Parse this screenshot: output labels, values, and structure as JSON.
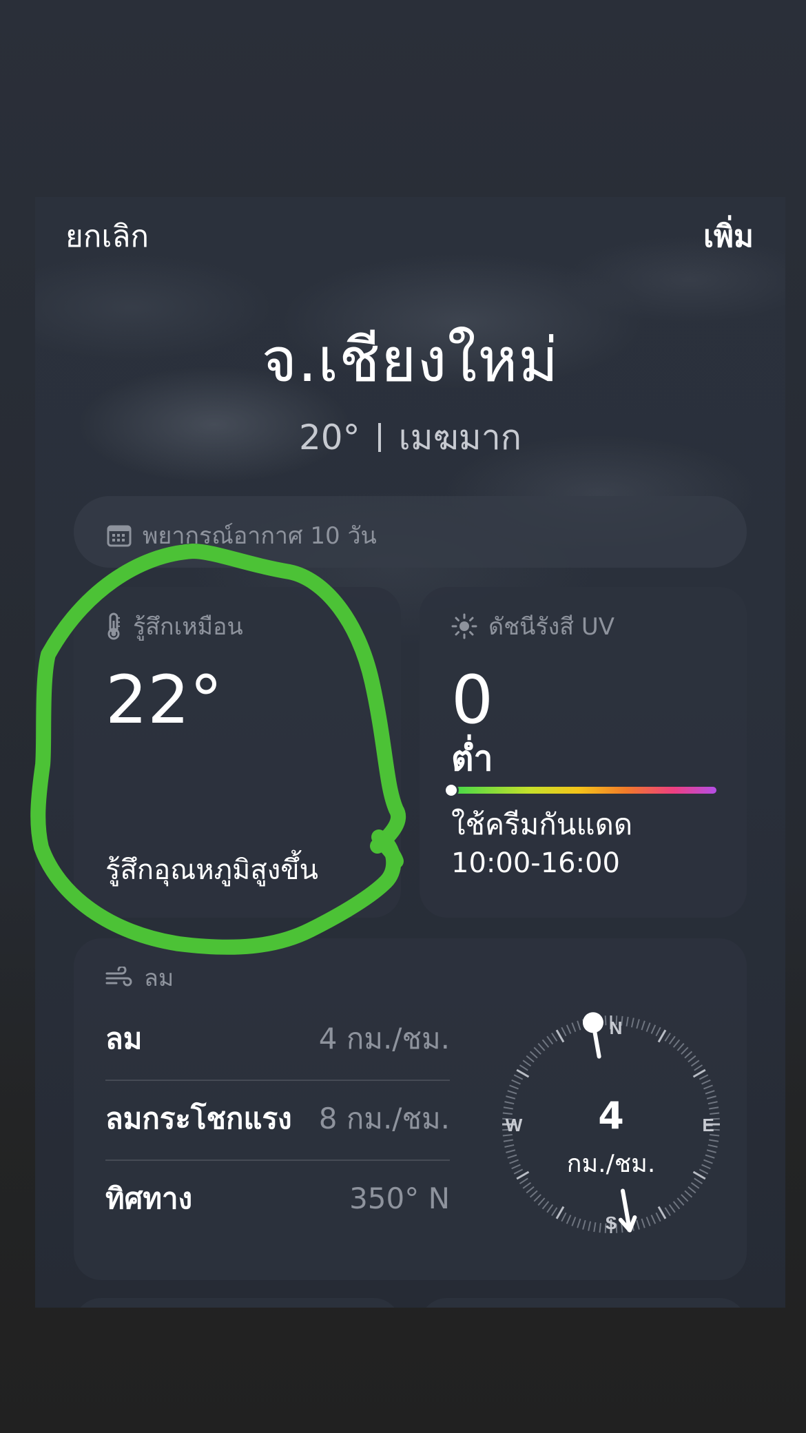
{
  "nav": {
    "cancel_label": "ยกเลิก",
    "add_label": "เพิ่ม"
  },
  "location": {
    "city": "จ.เชียงใหม่",
    "temperature": "20°",
    "condition": "เมฆมาก"
  },
  "forecast": {
    "icon": "calendar-icon",
    "label": "พยากรณ์อากาศ 10 วัน"
  },
  "feels_like": {
    "icon": "thermometer-icon",
    "title": "รู้สึกเหมือน",
    "value": "22°",
    "description": "รู้สึกอุณหภูมิสูงขึ้น"
  },
  "uv_index": {
    "icon": "sun-icon",
    "title": "ดัชนีรังสี UV",
    "value": "0",
    "level": "ต่ำ",
    "level_fraction": 0,
    "advice": "ใช้ครีมกันแดด",
    "time_range": "10:00-16:00"
  },
  "wind": {
    "icon": "wind-icon",
    "title": "ลม",
    "rows": [
      {
        "label": "ลม",
        "value": "4 กม./ชม."
      },
      {
        "label": "ลมกระโชกแรง",
        "value": "8 กม./ชม."
      },
      {
        "label": "ทิศทาง",
        "value": "350° N"
      }
    ],
    "compass": {
      "speed": "4",
      "unit": "กม./ชม.",
      "direction_degrees": 350,
      "north": "N",
      "east": "E",
      "south": "S",
      "west": "W"
    }
  },
  "colors": {
    "background": "#2a2f39",
    "card": "#2c323e",
    "secondary_text": "#8e939d",
    "annotation": "#4cc236"
  }
}
